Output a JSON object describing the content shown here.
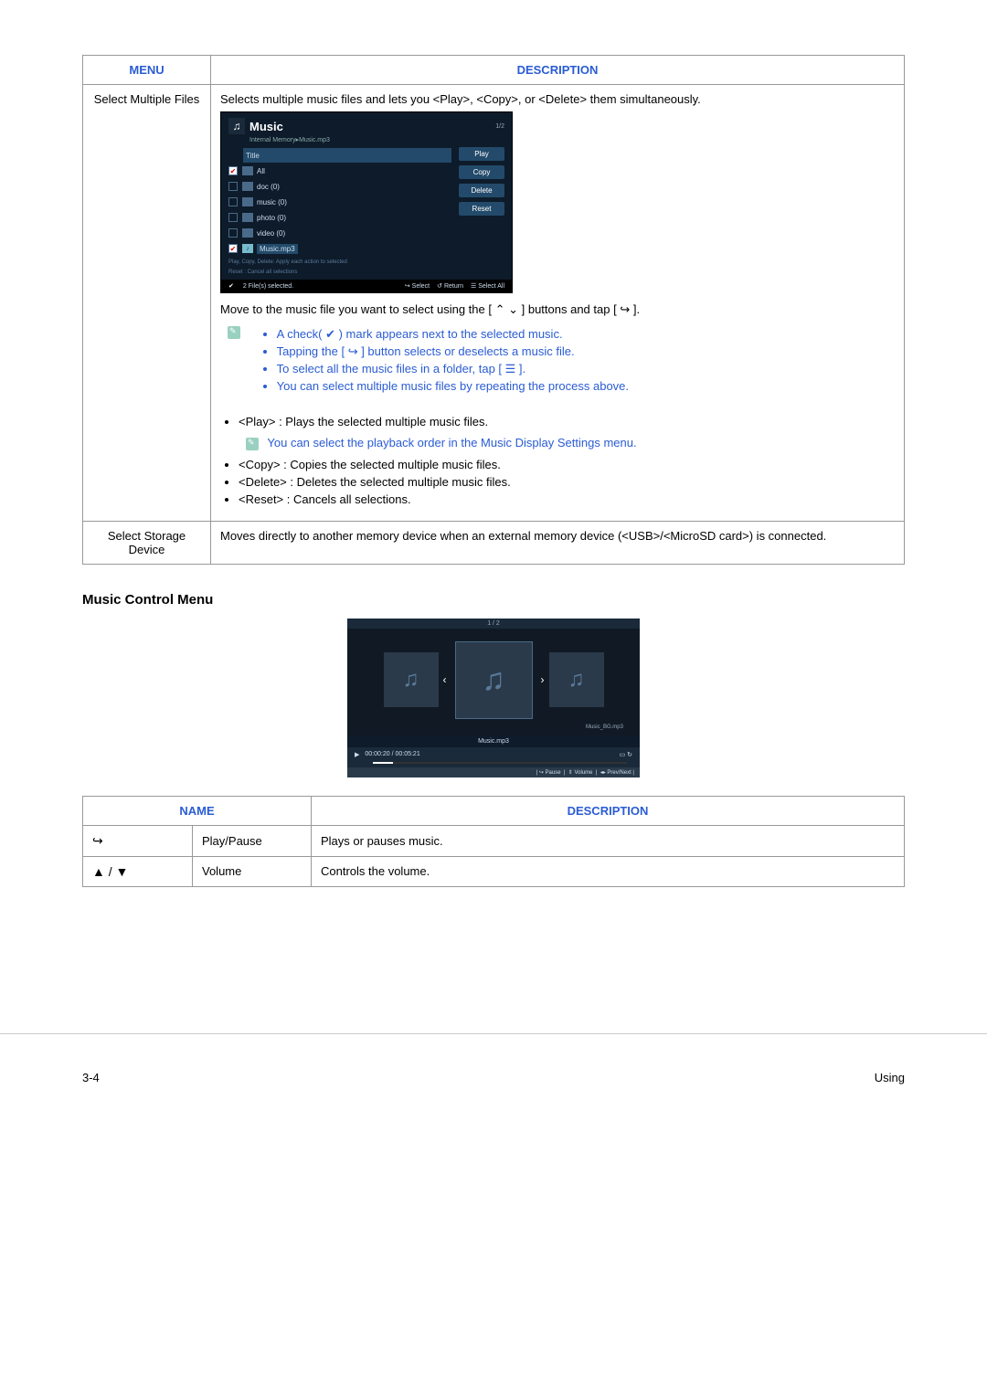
{
  "table1": {
    "headers": {
      "menu": "MENU",
      "desc": "DESCRIPTION"
    },
    "row1": {
      "menu": "Select Multiple Files",
      "intro": "Selects multiple music files and lets you <Play>, <Copy>, or <Delete> them simultaneously.",
      "move_line_a": "Move to the music file you want to select using the [ ",
      "move_line_b": " ] buttons and tap [ ",
      "move_line_c": " ].",
      "note1a": "A check( ",
      "note1b": " ) mark appears next to the selected music.",
      "note2a": "Tapping the [ ",
      "note2b": " ] button selects or deselects a music file.",
      "note3a": "To select all the music files in a folder, tap [ ",
      "note3b": " ].",
      "note4": "You can select multiple music files by repeating the process above.",
      "play": "<Play> : Plays the selected multiple music files.",
      "play_note": "You can select the playback order in the Music Display Settings menu.",
      "copy": "<Copy> : Copies the selected multiple music files.",
      "delete": "<Delete> : Deletes the selected multiple music files.",
      "reset": "<Reset> : Cancels all selections."
    },
    "row2": {
      "menu": "Select Storage Device",
      "desc": "Moves directly to another memory device when an external memory device (<USB>/<MicroSD card>) is connected."
    }
  },
  "ss1": {
    "title": "Music",
    "path": "Internal Memory▸Music.mp3",
    "page": "1/2",
    "col_title": "Title",
    "items": {
      "all": "All",
      "doc": "doc (0)",
      "music": "music (0)",
      "photo": "photo (0)",
      "video": "video (0)",
      "file": "Music.mp3"
    },
    "buttons": {
      "play": "Play",
      "copy": "Copy",
      "delete": "Delete",
      "reset": "Reset"
    },
    "hint1": "Play, Copy, Delete: Apply each action to selected",
    "hint2": "Reset : Cancel all selections",
    "footer": {
      "selected": "2 File(s) selected.",
      "select": "Select",
      "return": "Return",
      "select_all": "Select All"
    }
  },
  "section2_title": "Music Control Menu",
  "ss2": {
    "page": "1 / 2",
    "right_name": "Music_BG.mp3",
    "current": "Music.mp3",
    "time": "00:00:20 / 00:05:21",
    "hint_pause": "Pause",
    "hint_volume": "Volume",
    "hint_prevnext": "Prev/Next"
  },
  "table2": {
    "headers": {
      "name": "NAME",
      "desc": "DESCRIPTION"
    },
    "rows": [
      {
        "name": "Play/Pause",
        "desc": "Plays or pauses music."
      },
      {
        "name": "Volume",
        "desc": "Controls the volume."
      }
    ]
  },
  "footer": {
    "page": "3-4",
    "section": "Using"
  },
  "symbols": {
    "updown_caret": "⌃ ⌄",
    "enter": "↪",
    "check": "✔",
    "list_all": "☰",
    "updown_tri": "▲ / ▼",
    "music_note": "♫",
    "chev_l": "‹",
    "chev_r": "›",
    "play_tri": "▶"
  }
}
